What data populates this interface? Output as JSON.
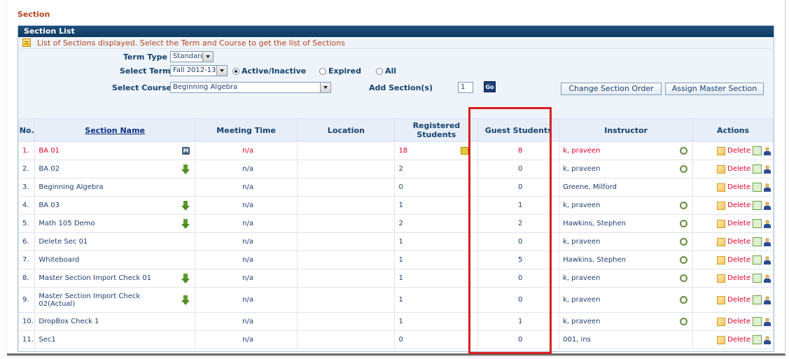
{
  "page": {
    "title": "Section"
  },
  "panel": {
    "header": "Section List",
    "info": "List of Sections displayed. Select the Term and Course to get the list of Sections"
  },
  "filters": {
    "term_type_label": "Term Type",
    "term_type_value": "Standard",
    "select_term_label": "Select Term",
    "select_term_value": "Fall 2012-13",
    "radio_active": "Active/Inactive",
    "radio_expired": "Expired",
    "radio_all": "All",
    "select_course_label": "Select Course",
    "select_course_value": "Beginning Algebra",
    "add_sections_label": "Add Section(s)",
    "add_sections_value": "1",
    "go_label": "Go",
    "change_order_label": "Change Section Order",
    "assign_master_label": "Assign Master Section"
  },
  "table": {
    "headers": {
      "no": "No.",
      "name": "Section Name",
      "time": "Meeting Time",
      "location": "Location",
      "registered": "Registered Students",
      "guest": "Guest Students",
      "instructor": "Instructor",
      "actions": "Actions"
    },
    "delete_label": "Delete",
    "rows": [
      {
        "no": "1.",
        "name": "BA 01",
        "time": "n/a",
        "registered": "18",
        "guest": "8",
        "instructor": "k, praveen"
      },
      {
        "no": "2.",
        "name": "BA 02",
        "time": "n/a",
        "registered": "2",
        "guest": "0",
        "instructor": "k, praveen"
      },
      {
        "no": "3.",
        "name": "Beginning Algebra",
        "time": "n/a",
        "registered": "0",
        "guest": "0",
        "instructor": "Greene, Milford"
      },
      {
        "no": "4.",
        "name": "BA 03",
        "time": "n/a",
        "registered": "1",
        "guest": "1",
        "instructor": "k, praveen"
      },
      {
        "no": "5.",
        "name": "Math 105 Demo",
        "time": "n/a",
        "registered": "2",
        "guest": "2",
        "instructor": "Hawkins, Stephen"
      },
      {
        "no": "6.",
        "name": "Delete Sec 01",
        "time": "n/a",
        "registered": "1",
        "guest": "0",
        "instructor": "k, praveen"
      },
      {
        "no": "7.",
        "name": "Whiteboard",
        "time": "n/a",
        "registered": "1",
        "guest": "5",
        "instructor": "Hawkins, Stephen"
      },
      {
        "no": "8.",
        "name": "Master Section Import Check 01",
        "time": "n/a",
        "registered": "1",
        "guest": "0",
        "instructor": "k, praveen"
      },
      {
        "no": "9.",
        "name": "Master Section Import Check 02(Actual)",
        "time": "n/a",
        "registered": "1",
        "guest": "0",
        "instructor": "k, praveen"
      },
      {
        "no": "10.",
        "name": "DropBox Check 1",
        "time": "n/a",
        "registered": "1",
        "guest": "1",
        "instructor": "k, praveen"
      },
      {
        "no": "11.",
        "name": "Sec1",
        "time": "n/a",
        "registered": "0",
        "guest": "0",
        "instructor": "001, ins"
      }
    ]
  },
  "colors": {
    "accent": "#1f4f7c",
    "title": "#b8431c",
    "alert": "#e0002b",
    "highlight": "#d62121"
  }
}
